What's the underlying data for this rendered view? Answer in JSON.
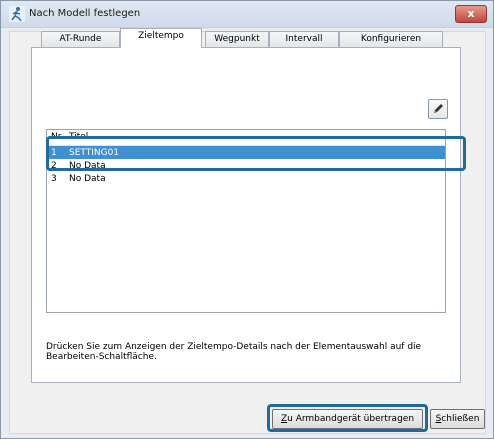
{
  "window": {
    "title": "Nach Modell festlegen",
    "close_glyph": "x"
  },
  "tabs": [
    {
      "label": "AT-Runde",
      "active": false
    },
    {
      "label": "Zieltempo",
      "active": true
    },
    {
      "label": "Wegpunkt",
      "active": false
    },
    {
      "label": "Intervall",
      "active": false
    },
    {
      "label": "Konfigurieren",
      "active": false
    }
  ],
  "list": {
    "columns": [
      "Nr.",
      "Titel"
    ],
    "rows": [
      {
        "nr": "1",
        "title": "SETTING01",
        "selected": true
      },
      {
        "nr": "2",
        "title": "No Data",
        "selected": false
      },
      {
        "nr": "3",
        "title": "No Data",
        "selected": false
      }
    ]
  },
  "description": "Drücken Sie zum Anzeigen der Zieltempo-Details nach der Elementauswahl auf die Bearbeiten-Schaltfläche.",
  "buttons": {
    "transfer_mnemonic": "Z",
    "transfer_rest": "u Armbandgerät übertragen",
    "close_mnemonic": "S",
    "close_rest": "chließen"
  },
  "icons": {
    "app": "runner-icon",
    "edit": "pencil-icon"
  },
  "colors": {
    "selection": "#3f8fd1",
    "highlight_border": "#1e6c9c",
    "close_button": "#c3463a"
  }
}
